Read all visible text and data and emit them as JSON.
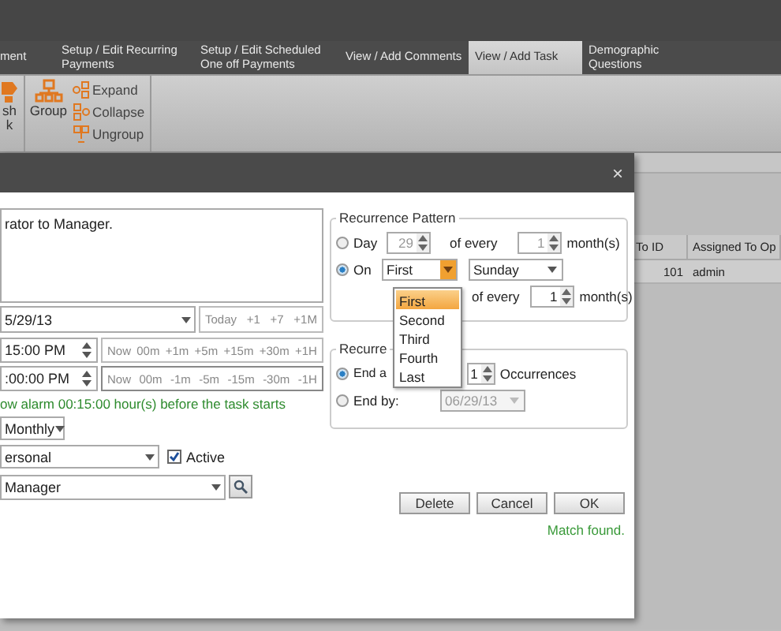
{
  "app_tabs": [
    {
      "label": "ment",
      "selected": false
    },
    {
      "label": "Setup / Edit Recurring Payments",
      "selected": false
    },
    {
      "label": "Setup / Edit Scheduled One off Payments",
      "selected": false
    },
    {
      "label": "View / Add Comments",
      "selected": false
    },
    {
      "label": "View / Add Task",
      "selected": true
    },
    {
      "label": "Demographic Questions",
      "selected": false
    }
  ],
  "ribbon": {
    "large_buttons": [
      {
        "label": "sh k",
        "kind": "partial"
      },
      {
        "label": "Group",
        "kind": "group"
      }
    ],
    "small_buttons": [
      {
        "label": "Expand",
        "kind": "expand"
      },
      {
        "label": "Collapse",
        "kind": "collapse"
      },
      {
        "label": "Ungroup",
        "kind": "ungroup"
      }
    ]
  },
  "grid": {
    "columns": [
      "To ID",
      "Assigned To Op"
    ],
    "rows": [
      [
        "101",
        "admin"
      ]
    ]
  },
  "dialog": {
    "close": "×",
    "description": "rator to Manager.",
    "start_date": {
      "value": "5/29/13"
    },
    "date_buttons": [
      "Today",
      "+1",
      "+7",
      "+1M"
    ],
    "start_time": {
      "value": "15:00 PM"
    },
    "start_time_buttons": [
      "Now",
      "00m",
      "+1m",
      "+5m",
      "+15m",
      "+30m",
      "+1H"
    ],
    "alarm_time": {
      "value": ":00:00 PM"
    },
    "alarm_time_buttons": [
      "Now",
      "00m",
      "-1m",
      "-5m",
      "-15m",
      "-30m",
      "-1H"
    ],
    "alarm_note": "ow alarm 00:15:00 hour(s) before the task starts",
    "recurrence": {
      "value": "Monthly"
    },
    "category": {
      "value": "ersonal"
    },
    "active": {
      "label": "Active",
      "checked": true
    },
    "assignee": {
      "value": "Manager"
    },
    "pattern": {
      "title": "Recurrence Pattern",
      "day_option": {
        "label": "Day",
        "selected": false
      },
      "day_value": "29",
      "day_of_every": "of every",
      "day_every_value": "1",
      "day_months": "month(s)",
      "on_option": {
        "label": "On",
        "selected": true
      },
      "ordinal": "First",
      "weekday": "Sunday",
      "on_of_every": "of every",
      "on_every_value": "1",
      "on_months": "month(s)"
    },
    "ordinal_dropdown": [
      {
        "label": "First",
        "selected": true
      },
      {
        "label": "Second",
        "selected": false
      },
      {
        "label": "Third",
        "selected": false
      },
      {
        "label": "Fourth",
        "selected": false
      },
      {
        "label": "Last",
        "selected": false
      }
    ],
    "range": {
      "title": "Recurre",
      "after_option": {
        "label": "End a",
        "selected": true
      },
      "occurrences": "1",
      "occurrences_label": "Occurrences",
      "by_option": {
        "label": "End by:",
        "selected": false
      },
      "end_date": "06/29/13"
    },
    "buttons": [
      "Delete",
      "Cancel",
      "OK"
    ],
    "status": "Match found."
  }
}
